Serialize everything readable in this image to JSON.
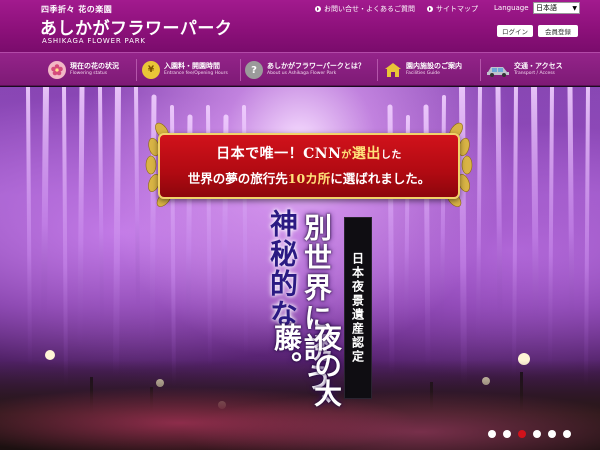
{
  "header": {
    "tagline": "四季折々 花の楽園",
    "logo": "あしかがフラワーパーク",
    "logo_en": "ASHIKAGA FLOWER PARK",
    "links": [
      "お問い合せ・よくあるご質問",
      "サイトマップ"
    ],
    "language_label": "Language",
    "language_value": "日本語",
    "login_label": "ログイン",
    "register_label": "会員登録"
  },
  "nav": {
    "items": [
      {
        "title": "現在の花の状況",
        "sub": "Flowering status"
      },
      {
        "title": "入園料・開園時間",
        "sub": "Entrance fee/Opening Hours"
      },
      {
        "title": "あしかがフラワーパークとは？",
        "sub": "About us Ashikaga Flower Park"
      },
      {
        "title": "園内施設のご案内",
        "sub": "Facilities Guide"
      },
      {
        "title": "交通・アクセス",
        "sub": "Transport / Access"
      }
    ]
  },
  "hero": {
    "banner_part1": "日本で唯一！",
    "banner_cnn": "CNN",
    "banner_part2": "が",
    "banner_part3": "選出",
    "banner_part4": "した",
    "banner_line2a": "世界の夢の旅行先",
    "banner_line2b": "10カ所",
    "banner_line2c": "に選ばれました。",
    "tag": "日本夜景遺産認定",
    "title_line1": "別世界に誘う、",
    "title_line2": "神秘的な",
    "title_line3": "夜の大藤。",
    "slides": 6,
    "active_slide": 3
  },
  "colors": {
    "header_bg": "#8b1079",
    "banner_red": "#c50e16",
    "accent_gold": "#f1d36a"
  }
}
